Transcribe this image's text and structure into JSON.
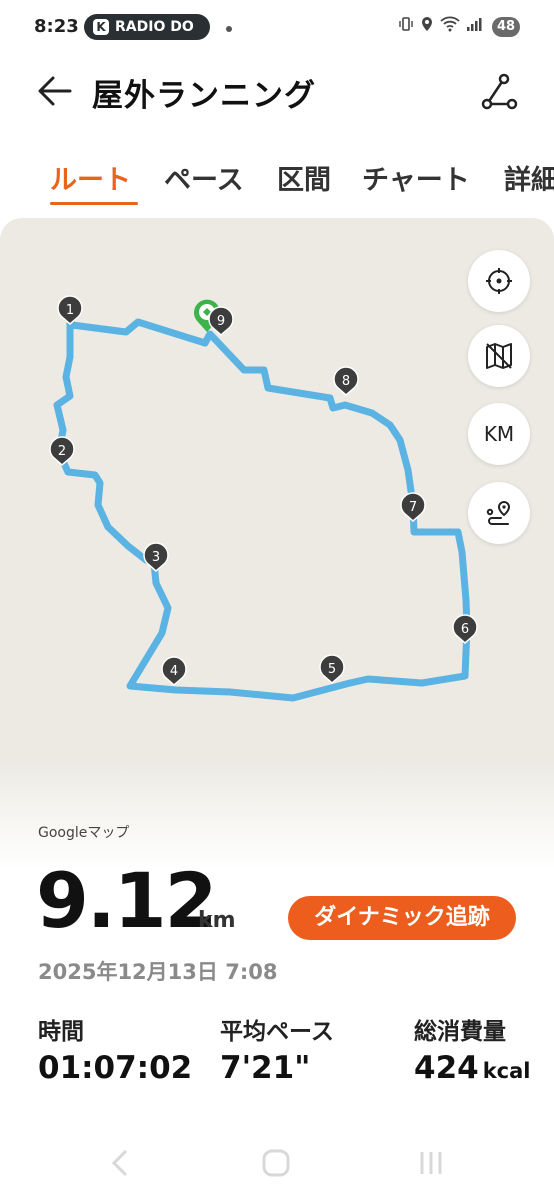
{
  "status_bar": {
    "time": "8:23",
    "notification_app": "RADIO DO",
    "battery": "48",
    "icons": [
      "vibrate-icon",
      "location-icon",
      "wifi-icon",
      "signal-icon"
    ]
  },
  "header": {
    "title": "屋外ランニング",
    "back_icon": "back-arrow-icon",
    "share_icon": "share-icon"
  },
  "tabs": [
    {
      "label": "ルート",
      "active": true
    },
    {
      "label": "ペース",
      "active": false
    },
    {
      "label": "区間",
      "active": false
    },
    {
      "label": "チャート",
      "active": false
    },
    {
      "label": "詳細",
      "active": false
    }
  ],
  "map": {
    "route_color": "#5ab3e3",
    "background": "#eceae3",
    "start_marker_color": "#3cb44b",
    "markers": [
      "1",
      "2",
      "3",
      "4",
      "5",
      "6",
      "7",
      "8",
      "9"
    ],
    "controls": [
      {
        "name": "recenter",
        "icon": "crosshair-icon"
      },
      {
        "name": "map-type",
        "icon": "map-icon"
      },
      {
        "name": "unit",
        "label": "KM"
      },
      {
        "name": "route-replay",
        "icon": "route-pin-icon"
      }
    ],
    "attribution": "Googleマップ",
    "watermark": "Google"
  },
  "summary": {
    "distance": "9.12",
    "distance_unit": "km",
    "tracking_button": "ダイナミック追跡",
    "datetime": "2025年12月13日 7:08"
  },
  "stats": [
    {
      "label": "時間",
      "value": "01:07:02",
      "unit": ""
    },
    {
      "label": "平均ペース",
      "value": "7'21\"",
      "unit": ""
    },
    {
      "label": "総消費量",
      "value": "424",
      "unit": "kcal"
    }
  ],
  "accent_color": "#e8641d"
}
